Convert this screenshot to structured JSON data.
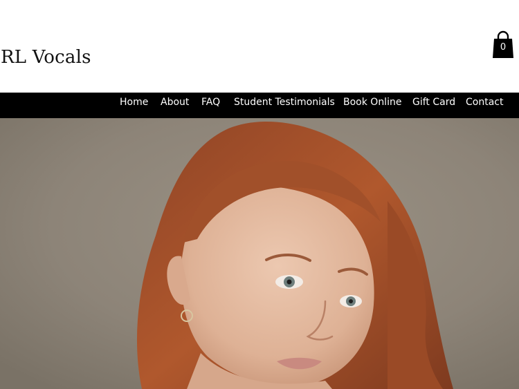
{
  "site": {
    "title": "RL Vocals"
  },
  "cart": {
    "icon": "shopping-bag-icon",
    "count": "0"
  },
  "nav": {
    "items": [
      {
        "label": "Home"
      },
      {
        "label": "About"
      },
      {
        "label": "FAQ"
      },
      {
        "label": "Student Testimonials"
      },
      {
        "label": "Book Online"
      },
      {
        "label": "Gift Card"
      },
      {
        "label": "Contact"
      }
    ]
  },
  "colors": {
    "nav_background": "#000000",
    "nav_text": "#ffffff",
    "hero_background": "#8d8478",
    "hair": "#a4512b",
    "skin": "#e2b9a0"
  }
}
